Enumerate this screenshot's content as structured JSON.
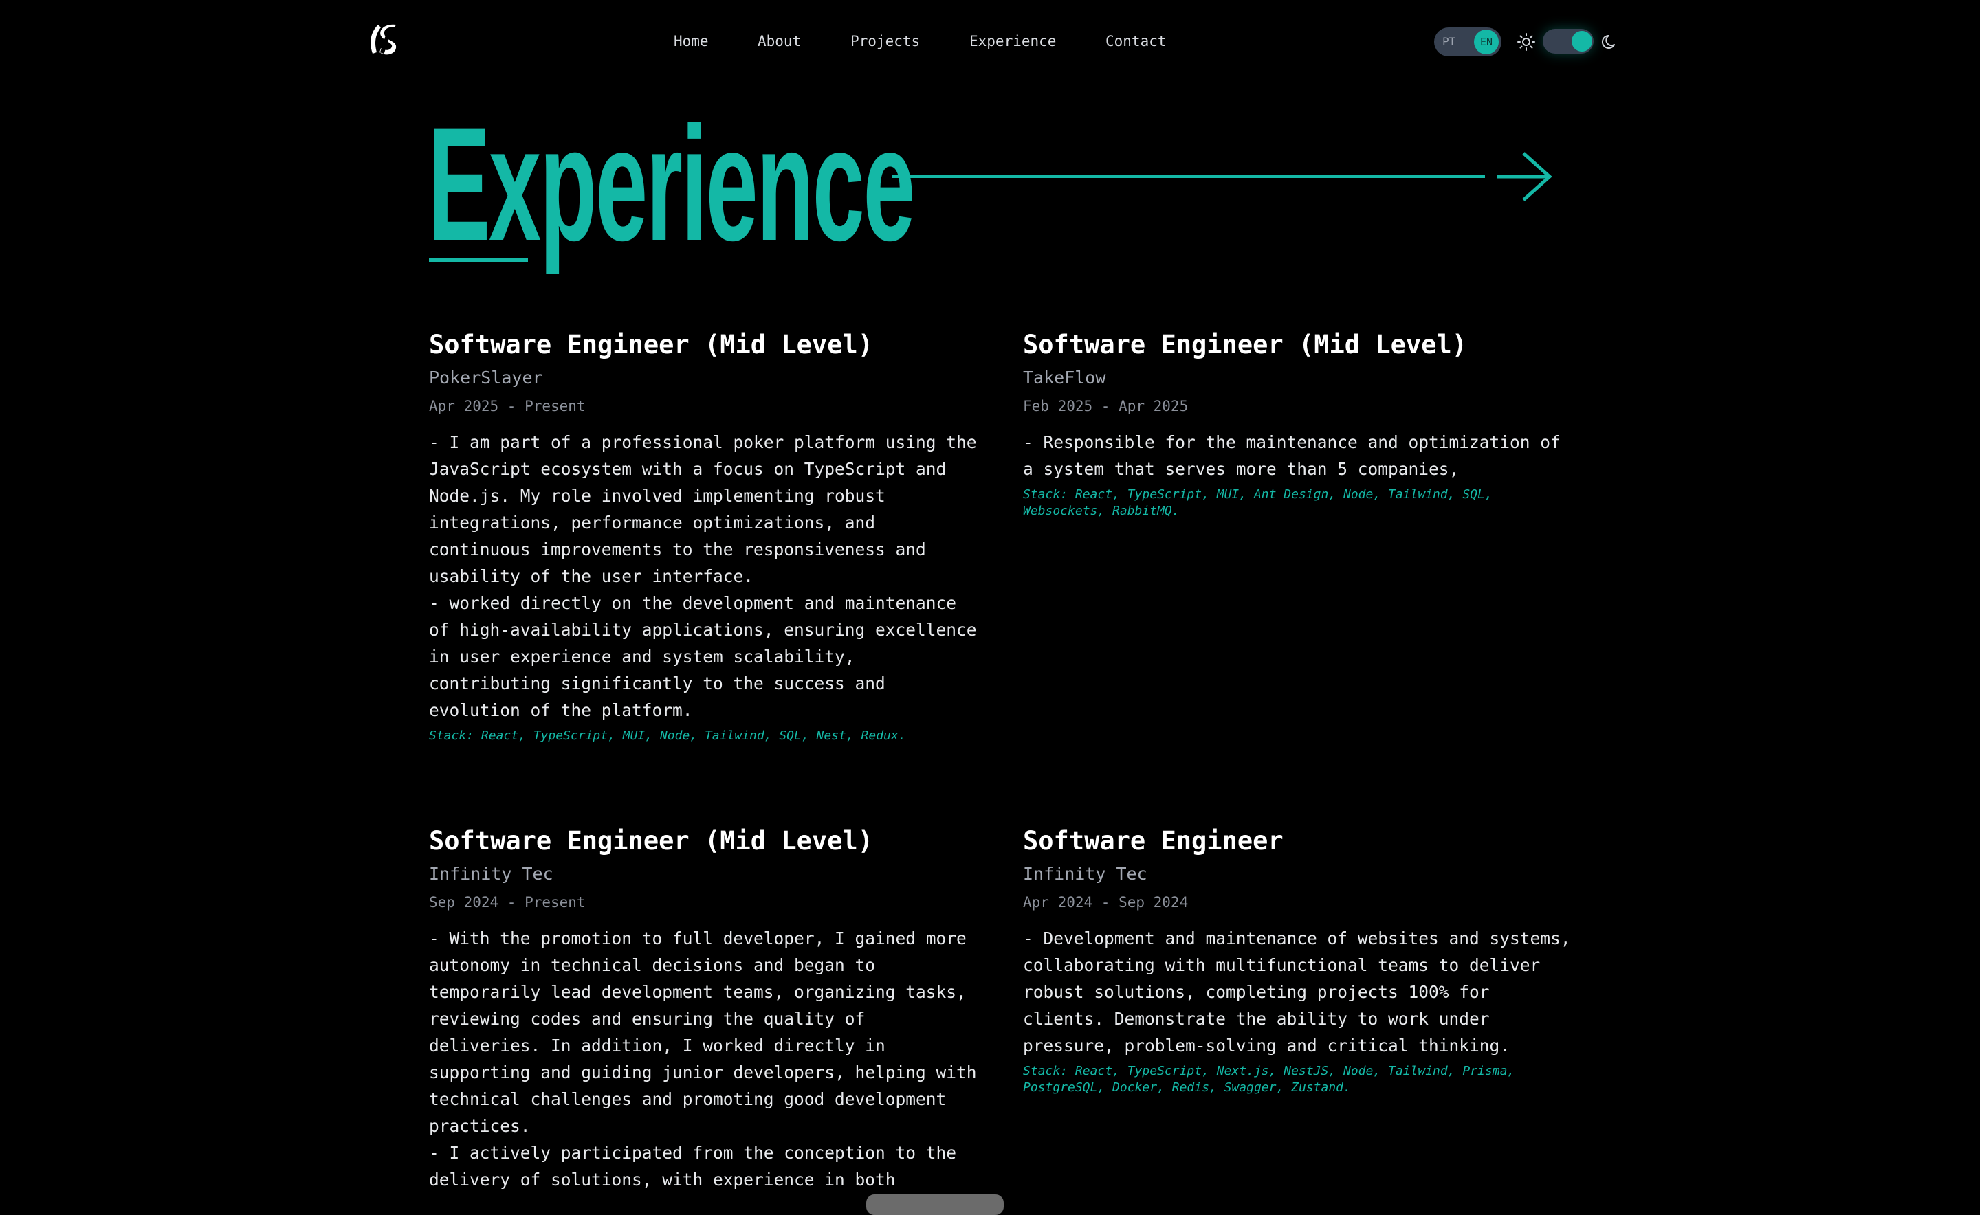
{
  "nav": {
    "logo_icon": "ls-monogram-logo",
    "links": [
      "Home",
      "About",
      "Projects",
      "Experience",
      "Contact"
    ]
  },
  "controls": {
    "lang_options": [
      "PT",
      "EN"
    ],
    "lang_selected": "EN",
    "theme_light_icon": "sun-icon",
    "theme_dark_icon": "moon-icon",
    "theme_selected": "dark"
  },
  "colors": {
    "accent": "#14b8a6",
    "background": "#000000",
    "text": "#ffffff",
    "muted": "#a3a8b2"
  },
  "section": {
    "title": "Experience",
    "arrow_icon": "arrow-right-icon"
  },
  "experiences": [
    {
      "title": "Software Engineer (Mid Level)",
      "company": "PokerSlayer",
      "dates": "Apr 2025 - Present",
      "description": "- I am part of a professional poker platform using the JavaScript ecosystem with a focus on TypeScript and Node.js. My role involved implementing robust integrations, performance optimizations, and continuous improvements to the responsiveness and usability of the user interface.\n- worked directly on the development and maintenance of high-availability applications, ensuring excellence in user experience and system scalability, contributing significantly to the success and evolution of the platform.",
      "stack": "Stack: React, TypeScript, MUI, Node, Tailwind, SQL, Nest, Redux."
    },
    {
      "title": "Software Engineer (Mid Level)",
      "company": "TakeFlow",
      "dates": "Feb 2025 - Apr 2025",
      "description": "- Responsible for the maintenance and optimization of a system that serves more than 5 companies,",
      "stack": "Stack: React, TypeScript, MUI, Ant Design, Node, Tailwind, SQL, Websockets, RabbitMQ."
    },
    {
      "title": "Software Engineer (Mid Level)",
      "company": "Infinity Tec",
      "dates": "Sep 2024 - Present",
      "description": "- With the promotion to full developer, I gained more autonomy in technical decisions and began to temporarily lead development teams, organizing tasks, reviewing codes and ensuring the quality of deliveries. In addition, I worked directly in supporting and guiding junior developers, helping with technical challenges and promoting good development practices.\n- I actively participated from the conception to the delivery of solutions, with experience in both",
      "stack": ""
    },
    {
      "title": "Software Engineer",
      "company": "Infinity Tec",
      "dates": "Apr 2024 - Sep 2024",
      "description": "- Development and maintenance of websites and systems, collaborating with multifunctional teams to deliver robust solutions, completing projects 100% for clients. Demonstrate the ability to work under pressure, problem-solving and critical thinking.",
      "stack": "Stack: React, TypeScript, Next.js, NestJS, Node, Tailwind, Prisma, PostgreSQL, Docker, Redis, Swagger, Zustand."
    }
  ]
}
